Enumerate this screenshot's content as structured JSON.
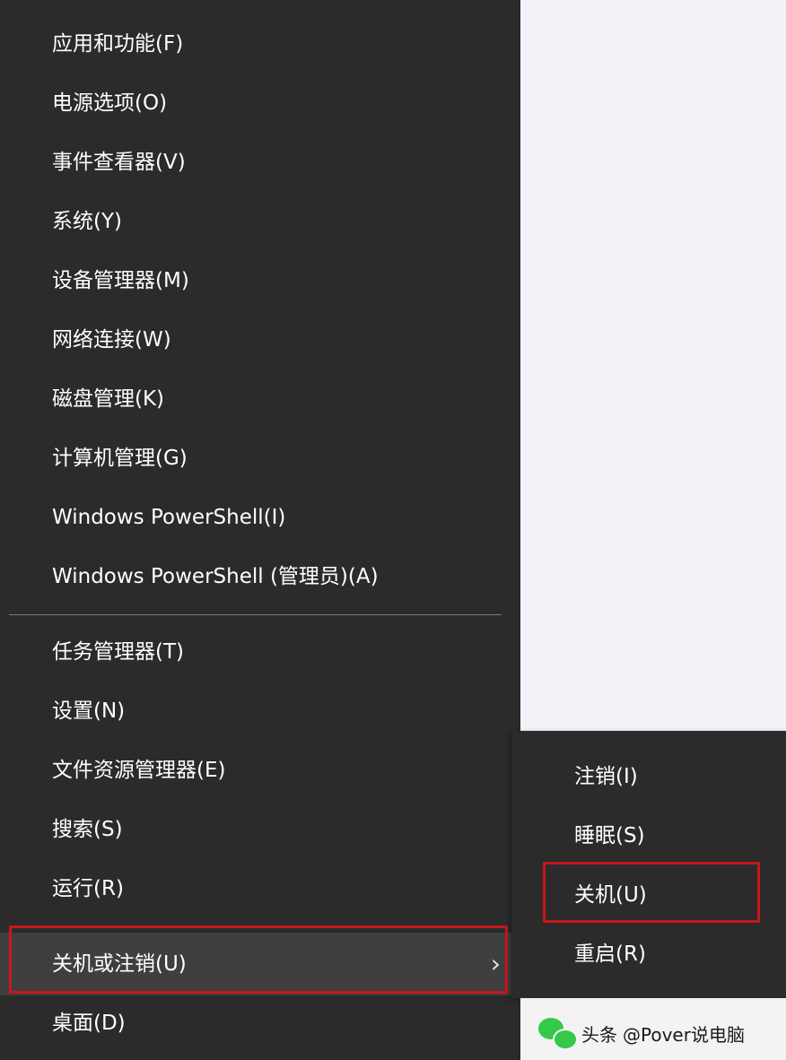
{
  "context_menu": {
    "items": [
      {
        "label": "应用和功能(F)"
      },
      {
        "label": "电源选项(O)"
      },
      {
        "label": "事件查看器(V)"
      },
      {
        "label": "系统(Y)"
      },
      {
        "label": "设备管理器(M)"
      },
      {
        "label": "网络连接(W)"
      },
      {
        "label": "磁盘管理(K)"
      },
      {
        "label": "计算机管理(G)"
      },
      {
        "label": "Windows PowerShell(I)"
      },
      {
        "label": "Windows PowerShell (管理员)(A)"
      },
      {
        "label": "任务管理器(T)"
      },
      {
        "label": "设置(N)"
      },
      {
        "label": "文件资源管理器(E)"
      },
      {
        "label": "搜索(S)"
      },
      {
        "label": "运行(R)"
      },
      {
        "label": "关机或注销(U)"
      },
      {
        "label": "桌面(D)"
      }
    ],
    "chevron": "›"
  },
  "submenu": {
    "items": [
      {
        "label": "注销(I)"
      },
      {
        "label": "睡眠(S)"
      },
      {
        "label": "关机(U)"
      },
      {
        "label": "重启(R)"
      }
    ]
  },
  "watermark": {
    "platform": "头条",
    "account": "@Pover说电脑",
    "icon": "wechat-icon"
  },
  "colors": {
    "menu_bg": "#2b2b2b",
    "highlight_border": "#c8161d",
    "wechat_green": "#34c94a"
  }
}
